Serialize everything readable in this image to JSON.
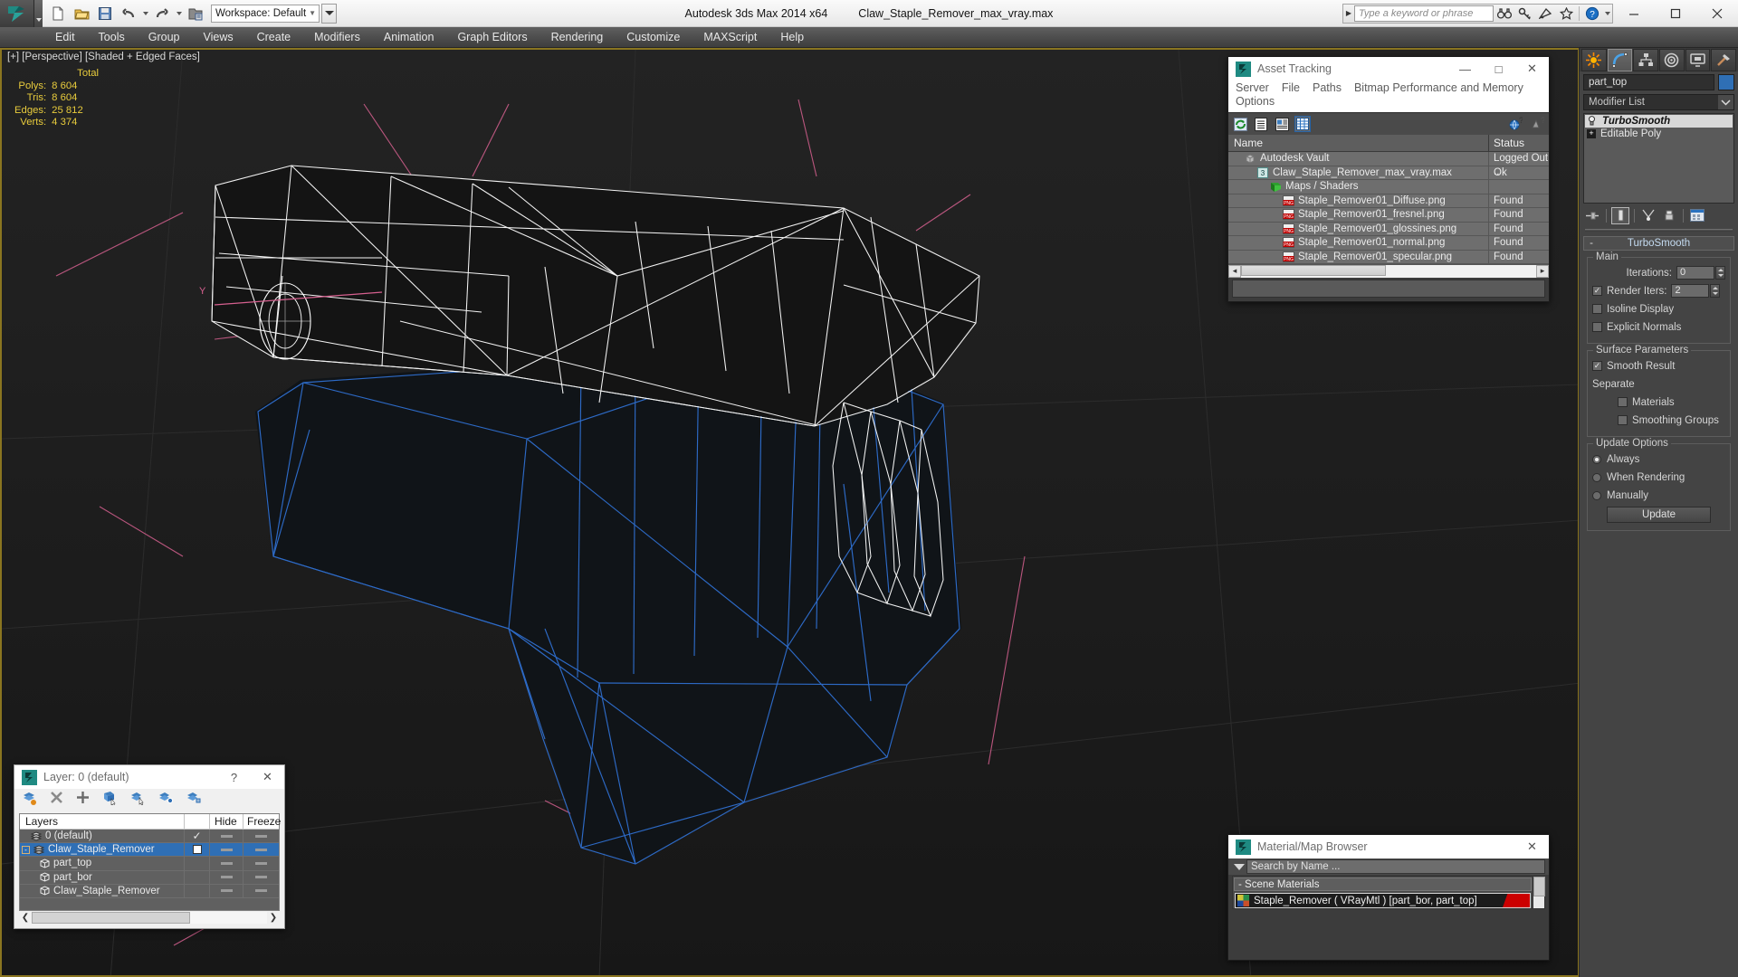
{
  "titlebar": {
    "app_title": "Autodesk 3ds Max  2014 x64",
    "file_title": "Claw_Staple_Remover_max_vray.max",
    "workspace_label": "Workspace: Default",
    "quick_access": [
      {
        "name": "new-file-icon",
        "label": "New"
      },
      {
        "name": "open-file-icon",
        "label": "Open"
      },
      {
        "name": "save-file-icon",
        "label": "Save"
      },
      {
        "name": "undo-icon",
        "label": "Undo"
      },
      {
        "name": "redo-icon",
        "label": "Redo"
      },
      {
        "name": "project-folder-icon",
        "label": "Set Project Folder"
      }
    ],
    "search_placeholder": "Type a keyword or phrase",
    "search_value": "",
    "right_icons": [
      "binoculars-icon",
      "key-icon",
      "satellite-dish-icon",
      "star-icon",
      "help-icon"
    ],
    "window_buttons": [
      "minimize-icon",
      "maximize-icon",
      "close-icon"
    ]
  },
  "menubar": {
    "items": [
      "Edit",
      "Tools",
      "Group",
      "Views",
      "Create",
      "Modifiers",
      "Animation",
      "Graph Editors",
      "Rendering",
      "Customize",
      "MAXScript",
      "Help"
    ]
  },
  "viewport": {
    "label": "[+] [Perspective] [Shaded + Edged Faces]",
    "stats_header": "Total",
    "stats": [
      {
        "key": "Polys:",
        "value": "8 604"
      },
      {
        "key": "Tris:",
        "value": "8 604"
      },
      {
        "key": "Edges:",
        "value": "25 812"
      },
      {
        "key": "Verts:",
        "value": "4 374"
      }
    ],
    "stats_color": "#e8cb3c",
    "border_color": "#8a7520",
    "background": "#1b1b1b"
  },
  "asset_tracking": {
    "title": "Asset Tracking",
    "menu": [
      "Server",
      "File",
      "Paths",
      "Bitmap Performance and Memory",
      "Options"
    ],
    "window_buttons": [
      "minimize-icon",
      "maximize-icon",
      "close-icon"
    ],
    "toolbar_icons": [
      "refresh-icon",
      "list-view-icon",
      "thumbnail-view-icon",
      "grid-view-icon",
      "help-globe-icon",
      "help-icon"
    ],
    "columns": [
      "Name",
      "Status"
    ],
    "rows": [
      {
        "indent": 1,
        "icon": "vault-icon",
        "name": "Autodesk Vault",
        "status": "Logged Out .."
      },
      {
        "indent": 2,
        "icon": "max-file-icon",
        "name": "Claw_Staple_Remover_max_vray.max",
        "status": "Ok"
      },
      {
        "indent": 3,
        "icon": "maps-shaders-icon",
        "name": "Maps / Shaders",
        "status": ""
      },
      {
        "indent": 4,
        "icon": "png-icon",
        "name": "Staple_Remover01_Diffuse.png",
        "status": "Found"
      },
      {
        "indent": 4,
        "icon": "png-icon",
        "name": "Staple_Remover01_fresnel.png",
        "status": "Found"
      },
      {
        "indent": 4,
        "icon": "png-icon",
        "name": "Staple_Remover01_glossines.png",
        "status": "Found"
      },
      {
        "indent": 4,
        "icon": "png-icon",
        "name": "Staple_Remover01_normal.png",
        "status": "Found"
      },
      {
        "indent": 4,
        "icon": "png-icon",
        "name": "Staple_Remover01_specular.png",
        "status": "Found"
      }
    ],
    "status_text": ""
  },
  "command_panel": {
    "tabs": [
      {
        "name": "create-tab",
        "icon": "star-burst-icon",
        "selected": false
      },
      {
        "name": "modify-tab",
        "icon": "curve-icon",
        "selected": true
      },
      {
        "name": "hierarchy-tab",
        "icon": "hierarchy-icon",
        "selected": false
      },
      {
        "name": "motion-tab",
        "icon": "wheel-icon",
        "selected": false
      },
      {
        "name": "display-tab",
        "icon": "monitor-icon",
        "selected": false
      },
      {
        "name": "utilities-tab",
        "icon": "hammer-icon",
        "selected": false
      }
    ],
    "object_name": "part_top",
    "object_color": "#2f6fb5",
    "modifier_list_label": "Modifier List",
    "stack": [
      {
        "label": "TurboSmooth",
        "selected": true,
        "icon": "light-bulb-icon"
      },
      {
        "label": "Editable Poly",
        "selected": false,
        "icon": "plus-box-icon"
      }
    ],
    "stack_tools": [
      "pin-stack-icon",
      "show-end-result-icon",
      "make-unique-icon",
      "remove-modifier-icon",
      "configure-sets-icon"
    ],
    "rollout": {
      "title": "TurboSmooth",
      "collapse_sign": "-",
      "groups": [
        {
          "title": "Main",
          "fields": [
            {
              "type": "spinner",
              "label": "Iterations:",
              "value": "0",
              "checkbox": false
            },
            {
              "type": "spinner",
              "label": "Render Iters:",
              "value": "2",
              "checkbox": true,
              "checked": true
            },
            {
              "type": "checkbox",
              "label": "Isoline Display",
              "checked": false
            },
            {
              "type": "checkbox",
              "label": "Explicit Normals",
              "checked": false
            }
          ]
        },
        {
          "title": "Surface Parameters",
          "fields": [
            {
              "type": "checkbox",
              "label": "Smooth Result",
              "checked": true
            },
            {
              "type": "text",
              "label": "Separate"
            },
            {
              "type": "checkbox-indent",
              "label": "Materials",
              "checked": false
            },
            {
              "type": "checkbox-indent",
              "label": "Smoothing Groups",
              "checked": false
            }
          ]
        },
        {
          "title": "Update Options",
          "fields": [
            {
              "type": "radio",
              "label": "Always",
              "checked": true
            },
            {
              "type": "radio",
              "label": "When Rendering",
              "checked": false
            },
            {
              "type": "radio",
              "label": "Manually",
              "checked": false
            },
            {
              "type": "button",
              "label": "Update"
            }
          ]
        }
      ]
    }
  },
  "layer_window": {
    "title": "Layer: 0 (default)",
    "help_button": "?",
    "close_button": "✕",
    "toolbar_icons": [
      "new-layer-icon",
      "delete-layer-icon",
      "add-layer-icon",
      "select-objects-icon",
      "select-layer-icon",
      "highlight-layer-icon",
      "layer-properties-icon"
    ],
    "columns": [
      "Layers",
      "",
      "Hide",
      "Freeze"
    ],
    "rows": [
      {
        "indent": 1,
        "icon": "layer-icon",
        "name": "0 (default)",
        "current": "✓",
        "selected": false,
        "expander": ""
      },
      {
        "indent": 0,
        "icon": "layer-icon",
        "name": "Claw_Staple_Remover",
        "current": "box",
        "selected": true,
        "expander": "-"
      },
      {
        "indent": 2,
        "icon": "object-icon",
        "name": "part_top",
        "current": "",
        "selected": false,
        "expander": ""
      },
      {
        "indent": 2,
        "icon": "object-icon",
        "name": "part_bor",
        "current": "",
        "selected": false,
        "expander": ""
      },
      {
        "indent": 2,
        "icon": "object-icon",
        "name": "Claw_Staple_Remover",
        "current": "",
        "selected": false,
        "expander": ""
      }
    ]
  },
  "material_browser": {
    "title": "Material/Map Browser",
    "close_button": "✕",
    "search_placeholder": "Search by Name ...",
    "search_value": "",
    "category": "- Scene Materials",
    "materials": [
      {
        "name": "Staple_Remover  ( VRayMtl )  [part_bor, part_top]",
        "swatch_accent": "#cc0000"
      }
    ]
  }
}
